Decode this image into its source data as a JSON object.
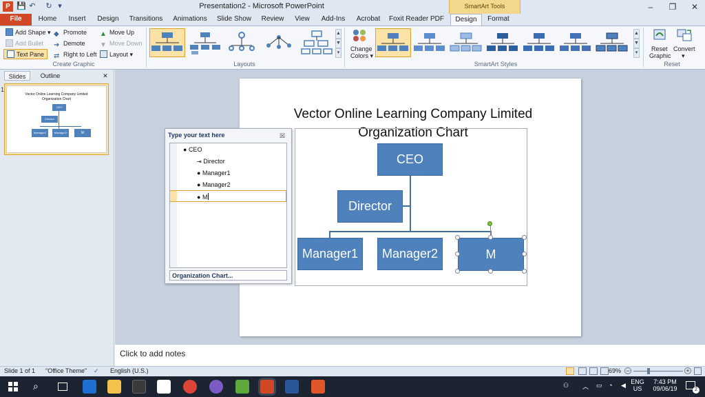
{
  "window": {
    "title": "Presentation2 - Microsoft PowerPoint",
    "context_tab_group": "SmartArt Tools",
    "min_glyph": "–",
    "max_glyph": "❐",
    "close_glyph": "✕"
  },
  "quick_access": {
    "save_glyph": "💾",
    "undo_glyph": "↶",
    "redo_glyph": "↻",
    "more_glyph": "▾"
  },
  "tabs": [
    "File",
    "Home",
    "Insert",
    "Design",
    "Transitions",
    "Animations",
    "Slide Show",
    "Review",
    "View",
    "Add-Ins",
    "Acrobat",
    "Foxit Reader PDF",
    "Design",
    "Format"
  ],
  "create_graphic": {
    "add_shape": "Add Shape",
    "add_bullet": "Add Bullet",
    "text_pane": "Text Pane",
    "promote": "Promote",
    "demote": "Demote",
    "right_to_left": "Right to Left",
    "move_up": "Move Up",
    "move_down": "Move Down",
    "layout": "Layout",
    "group_label": "Create Graphic"
  },
  "layouts": {
    "group_label": "Layouts"
  },
  "styles": {
    "change_colors_1": "Change",
    "change_colors_2": "Colors",
    "group_label": "SmartArt Styles"
  },
  "reset": {
    "reset_1": "Reset",
    "reset_2": "Graphic",
    "convert": "Convert",
    "group_label": "Reset"
  },
  "pane_tabs": {
    "slides": "Slides",
    "outline": "Outline",
    "close_glyph": "✕"
  },
  "thumbnail": {
    "number": "1",
    "title_1": "Vector Online Learning Company Limited",
    "title_2": "Organization Chart",
    "ceo": "CEO",
    "director": "Director",
    "m1": "Manager1",
    "m2": "Manager2",
    "m": "M"
  },
  "slide": {
    "title_line1": "Vector Online Learning Company Limited",
    "title_line2": "Organization Chart"
  },
  "org": {
    "ceo": "CEO",
    "director": "Director",
    "manager1": "Manager1",
    "manager2": "Manager2",
    "m": "M"
  },
  "text_pane": {
    "title": "Type your text here",
    "close_glyph": "☒",
    "items": [
      "CEO",
      "Director",
      "Manager1",
      "Manager2",
      "M"
    ],
    "footer_link": "Organization Chart..."
  },
  "notes": {
    "placeholder": "Click to add notes"
  },
  "status": {
    "slide": "Slide 1 of 1",
    "theme": "\"Office Theme\"",
    "language": "English (U.S.)",
    "zoom": "69%",
    "zoom_out": "−",
    "zoom_in": "+"
  },
  "taskbar": {
    "lang1": "ENG",
    "lang2": "US",
    "time": "7:43 PM",
    "date": "09/06/19",
    "search_glyph": "⌕",
    "notif_count": "2"
  },
  "colors": {
    "accent_file": "#d24726",
    "shape_fill": "#4f81bd",
    "selection": "#e0a030",
    "context_band": "#f3d78a"
  }
}
